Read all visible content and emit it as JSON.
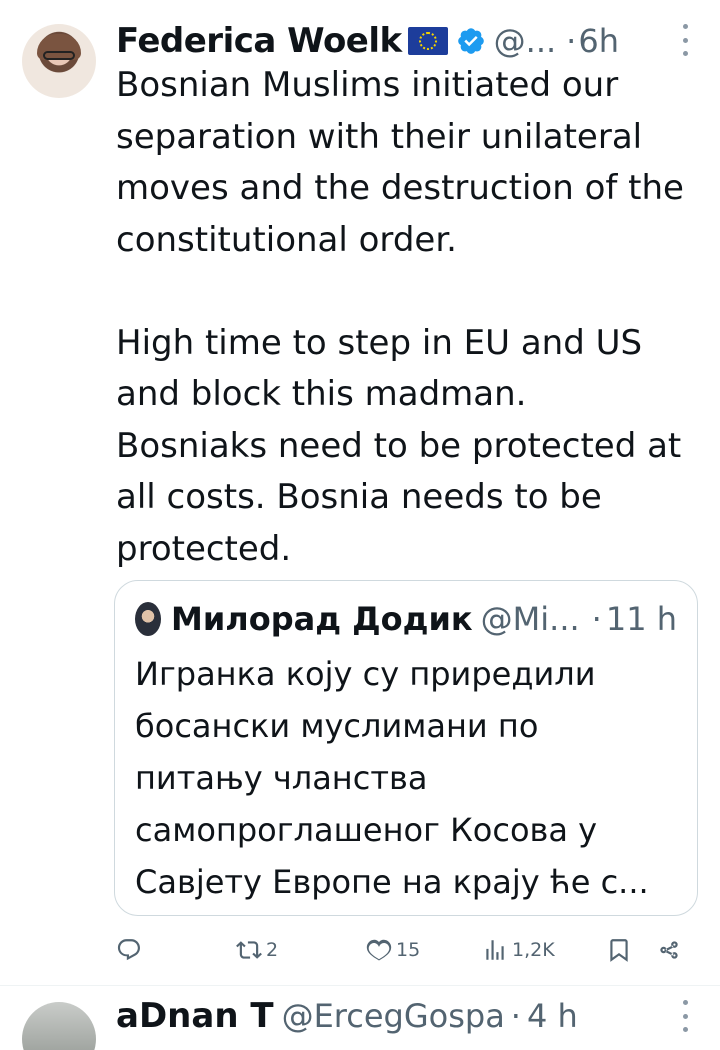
{
  "tweet": {
    "author_name": "Federica Woelk",
    "handle": "@...",
    "separator": "·",
    "time": "6h",
    "text_lines": [
      "Bosnian Muslims initiated our",
      "separation with their unilateral",
      "moves and the destruction of the",
      "constitutional order.",
      "",
      "High time to step in EU and US",
      "and block this madman.",
      "Bosniaks need to be protected at",
      "all costs. Bosnia needs to be",
      "protected."
    ],
    "quoted": {
      "author_name": "Милорад Додик",
      "handle": "@Mi...",
      "separator": "·",
      "time": "11 h",
      "text_lines": [
        "Игранка коју су приредили",
        "босански муслимани по",
        "питању чланства",
        "самопроглашеног Косова у",
        "Савјету Европе на крају ће с..."
      ]
    },
    "actions": {
      "reply_count": "",
      "retweet_count": "2",
      "like_count": "15",
      "views_count": "1,2K"
    }
  },
  "next_tweet": {
    "author_name": "aDnan T",
    "handle": "@ErcegGospa",
    "separator": "·",
    "time": "4 h"
  },
  "colors": {
    "text": "#0f1419",
    "secondary": "#536471",
    "verified": "#1d9bf0",
    "eu_flag": "#1d3d9b"
  },
  "icons": [
    "verified-badge-icon",
    "eu-flag-icon",
    "more-icon",
    "reply-icon",
    "retweet-icon",
    "like-icon",
    "views-icon",
    "bookmark-icon",
    "share-icon"
  ]
}
